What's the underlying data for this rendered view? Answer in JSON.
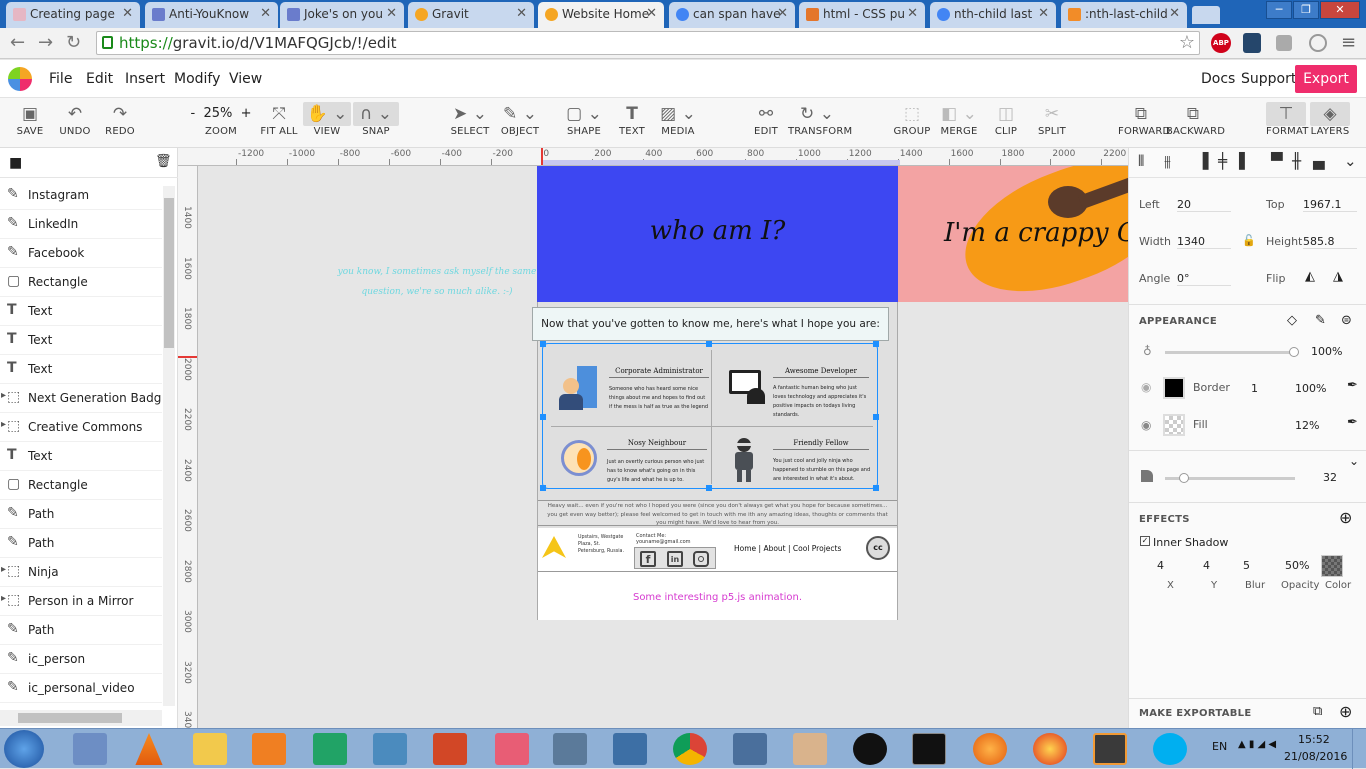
{
  "browser": {
    "tabs": [
      {
        "title": "Creating page",
        "color": "#e6b7c4"
      },
      {
        "title": "Anti-YouKnow",
        "color": "#6a7ccc"
      },
      {
        "title": "Joke's on you",
        "color": "#6a7ccc"
      },
      {
        "title": "Gravit",
        "color": "#f5a623"
      },
      {
        "title": "Website Home",
        "color": "#f5a623"
      },
      {
        "title": "can span have",
        "color": "#4285f4"
      },
      {
        "title": "html - CSS pu",
        "color": "#e4762b"
      },
      {
        "title": "nth-child last",
        "color": "#4285f4"
      },
      {
        "title": ":nth-last-child",
        "color": "#f28c28"
      }
    ],
    "url_scheme": "https://",
    "url_rest": "gravit.io/d/V1MAFQGJcb/!/edit",
    "ext_abp": "ABP"
  },
  "app": {
    "menu": [
      "File",
      "Edit",
      "Insert",
      "Modify",
      "View"
    ],
    "docs": "Docs",
    "support": "Support",
    "export": "Export"
  },
  "toolbar": {
    "save": "SAVE",
    "undo": "UNDO",
    "redo": "REDO",
    "zoom_value": "25%",
    "zoom_minus": "-",
    "zoom_plus": "+",
    "zoom": "ZOOM",
    "fitall": "FIT ALL",
    "view": "VIEW",
    "snap": "SNAP",
    "select": "SELECT",
    "object": "OBJECT",
    "shape": "SHAPE",
    "text": "TEXT",
    "media": "MEDIA",
    "edit": "EDIT",
    "transform": "TRANSFORM",
    "group": "GROUP",
    "merge": "MERGE",
    "clip": "CLIP",
    "split": "SPLIT",
    "forward": "FORWARD",
    "backward": "BACKWARD",
    "format": "FORMAT",
    "layers": "LAYERS"
  },
  "layers": [
    {
      "name": "Instagram",
      "icon": "pen"
    },
    {
      "name": "LinkedIn",
      "icon": "pen"
    },
    {
      "name": "Facebook",
      "icon": "pen"
    },
    {
      "name": "Rectangle",
      "icon": "rect"
    },
    {
      "name": "Text",
      "icon": "text"
    },
    {
      "name": "Text",
      "icon": "text"
    },
    {
      "name": "Text",
      "icon": "text"
    },
    {
      "name": "Next Generation Badge",
      "icon": "group"
    },
    {
      "name": "Creative Commons",
      "icon": "group"
    },
    {
      "name": "Text",
      "icon": "text"
    },
    {
      "name": "Rectangle",
      "icon": "rect"
    },
    {
      "name": "Path",
      "icon": "pen"
    },
    {
      "name": "Path",
      "icon": "pen"
    },
    {
      "name": "Ninja",
      "icon": "group"
    },
    {
      "name": "Person in a Mirror",
      "icon": "group"
    },
    {
      "name": "Path",
      "icon": "pen"
    },
    {
      "name": "ic_person",
      "icon": "pen"
    },
    {
      "name": "ic_personal_video",
      "icon": "pen"
    }
  ],
  "rulers": {
    "h": [
      "-1200",
      "-1000",
      "-800",
      "-600",
      "-400",
      "-200",
      "0",
      "200",
      "400",
      "600",
      "800",
      "1000",
      "1200",
      "1400",
      "1600",
      "1800",
      "2000",
      "2200"
    ],
    "v": [
      "1400",
      "1600",
      "1800",
      "2000",
      "2200",
      "2400",
      "2600",
      "2800",
      "3000",
      "3200",
      "3400"
    ]
  },
  "canvas": {
    "side_note": "you know, I sometimes ask myself the same question, we're so much alike. :-)",
    "who_am_i": "who am I?",
    "crappy": "I'm a crappy G",
    "hope_title": "Now that you've gotten to know me, here's what I hope you are:",
    "cards": [
      {
        "title": "Corporate Administrator",
        "body": "Someone who has heard some nice things about me and hopes to find out if the mess is half as true as the legend"
      },
      {
        "title": "Awesome Developer",
        "body": "A fantastic human being who just loves technology and appreciates it's positive impacts on todays living standards."
      },
      {
        "title": "Nosy Neighbour",
        "body": "Just an overtly curious person who just has to know what's going on in this guy's life and what he is up to."
      },
      {
        "title": "Friendly Fellow",
        "body": "You just cool and jolly ninja who happened to stumble on this page and are interested in what it's about."
      }
    ],
    "footer_note": "Heavy wait... even if you're not who I hoped you were (since you don't always get what you hope for because sometimes... you get even way better); please feel welcomed to get in touch with me ith any amazing ideas, thoughts or comments that you might have. We'd love to hear from you.",
    "address": "Upstairs, Westgate Plaza, St. Petersburg, Russia.",
    "contact_label": "Contact Me:",
    "contact_email": "youname@gmail.com",
    "links": "Home | About | Cool Projects",
    "cc": "cc",
    "animation": "Some interesting p5.js animation."
  },
  "inspector": {
    "left_label": "Left",
    "left": "20",
    "top_label": "Top",
    "top": "1967.1",
    "width_label": "Width",
    "width": "1340",
    "height_label": "Height",
    "height": "585.8",
    "angle_label": "Angle",
    "angle": "0°",
    "flip_label": "Flip",
    "appearance": "APPEARANCE",
    "opacity": "100%",
    "border_label": "Border",
    "border_width": "1",
    "border_opacity": "100%",
    "fill_label": "Fill",
    "fill_opacity": "12%",
    "radius": "32",
    "effects": "EFFECTS",
    "inner_shadow": "Inner Shadow",
    "shadow_values": [
      "4",
      "4",
      "5",
      "50%"
    ],
    "shadow_labels": [
      "X",
      "Y",
      "Blur",
      "Opacity",
      "Color"
    ],
    "make_exportable": "MAKE EXPORTABLE"
  },
  "taskbar": {
    "lang": "EN",
    "time": "15:52",
    "date": "21/08/2016"
  },
  "colors": {
    "accent": "#ef2d6c",
    "selection": "#1e90ff",
    "hero_blue": "#3d47f2",
    "hero_pink": "#f3a3a3",
    "guitar": "#f79a16"
  }
}
